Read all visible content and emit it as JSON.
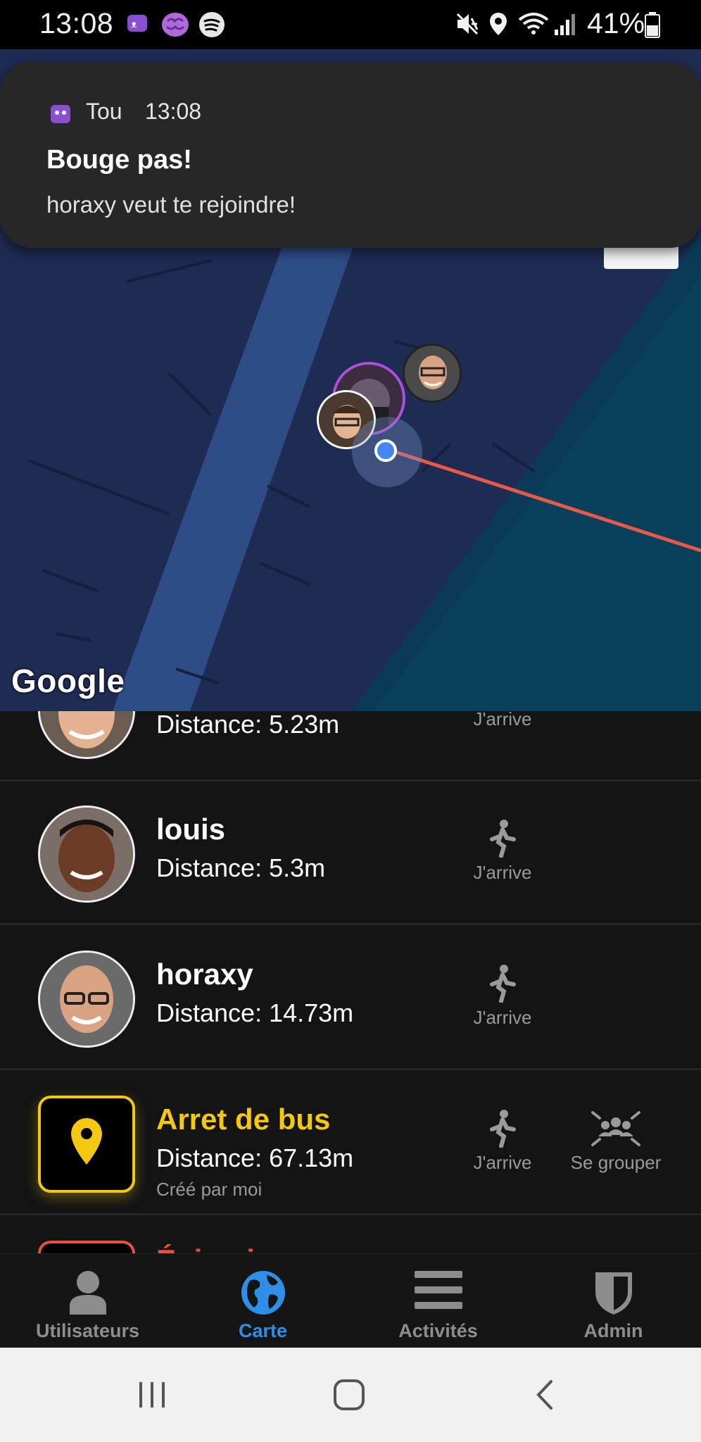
{
  "status_bar": {
    "time": "13:08",
    "battery_percent": "41%",
    "icons": [
      "app-icon",
      "brain-icon",
      "spotify-icon",
      "mute-icon",
      "location-icon",
      "wifi-icon",
      "signal-icon",
      "battery-icon"
    ]
  },
  "notification": {
    "app_name": "Tou",
    "time": "13:08",
    "title": "Bouge pas!",
    "body": "horaxy veut te rejoindre!"
  },
  "map": {
    "attribution": "Google"
  },
  "list": {
    "rows": [
      {
        "name": "",
        "distance": "Distance: 5.23m",
        "action_label": "J'arrive"
      },
      {
        "name": "louis",
        "distance": "Distance: 5.3m",
        "action_label": "J'arrive"
      },
      {
        "name": "horaxy",
        "distance": "Distance: 14.73m",
        "action_label": "J'arrive"
      },
      {
        "name": "Arret de bus",
        "distance": "Distance: 67.13m",
        "creator": "Créé par moi",
        "action_label": "J'arrive",
        "group_label": "Se grouper",
        "color": "#f4c711"
      },
      {
        "name": "Épicerie",
        "color": "#e8513d"
      }
    ]
  },
  "bottom_nav": {
    "items": [
      {
        "label": "Utilisateurs",
        "icon": "user-icon",
        "active": false
      },
      {
        "label": "Carte",
        "icon": "globe-icon",
        "active": true
      },
      {
        "label": "Activités",
        "icon": "menu-icon",
        "active": false
      },
      {
        "label": "Admin",
        "icon": "shield-icon",
        "active": false
      }
    ],
    "active_color": "#2f8fe8"
  }
}
